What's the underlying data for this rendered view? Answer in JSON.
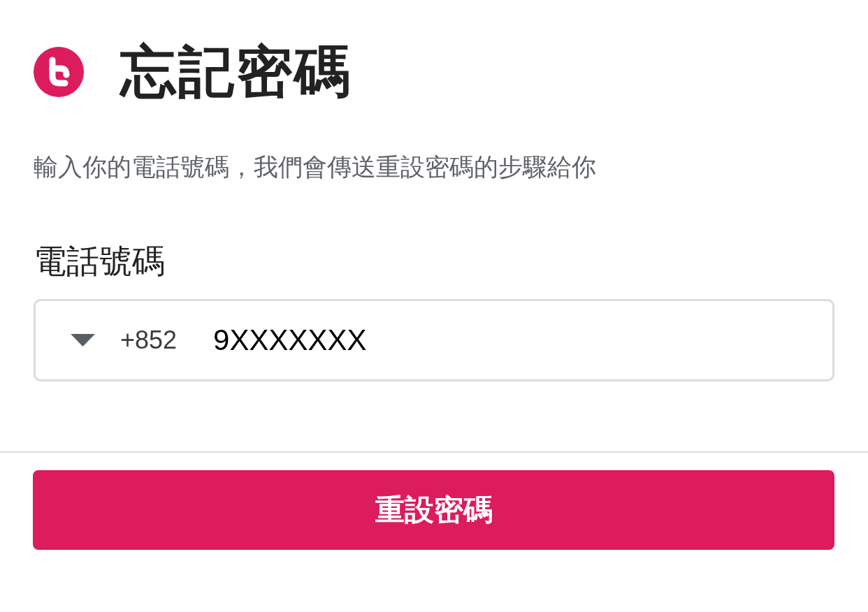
{
  "header": {
    "title": "忘記密碼"
  },
  "description": "輸入你的電話號碼，我們會傳送重設密碼的步驟給你",
  "phone_field": {
    "label": "電話號碼",
    "country_code": "+852",
    "value": "9XXXXXXX"
  },
  "submit_button": {
    "label": "重設密碼"
  }
}
